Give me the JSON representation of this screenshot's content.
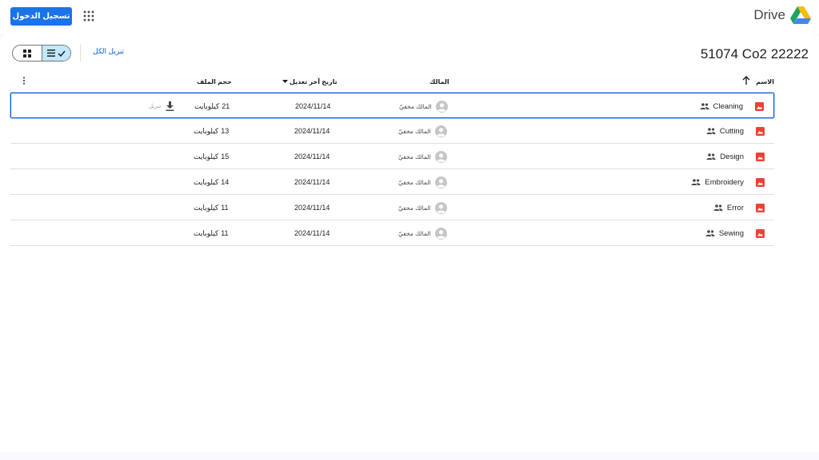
{
  "header": {
    "signin_label": "تسجيل الدخول",
    "brand_name": "Drive"
  },
  "toolbar": {
    "download_all_label": "تنزيل الكل",
    "folder_title": "51074 Co2 22222",
    "view_mode": "list"
  },
  "table": {
    "columns": {
      "name": "الاسم",
      "owner": "المالك",
      "modified": "تاريخ آخر تعديل",
      "size": "حجم الملف"
    },
    "download_label": "تنزيل",
    "rows": [
      {
        "name": "Cleaning",
        "owner": "المالك مخفيّ",
        "modified": "2024/11/14",
        "size_value": "21",
        "size_unit": "كيلوبايت",
        "selected": true
      },
      {
        "name": "Cutting",
        "owner": "المالك مخفيّ",
        "modified": "2024/11/14",
        "size_value": "13",
        "size_unit": "كيلوبايت"
      },
      {
        "name": "Design",
        "owner": "المالك مخفيّ",
        "modified": "2024/11/14",
        "size_value": "15",
        "size_unit": "كيلوبايت"
      },
      {
        "name": "Embroidery",
        "owner": "المالك مخفيّ",
        "modified": "2024/11/14",
        "size_value": "14",
        "size_unit": "كيلوبايت"
      },
      {
        "name": "Error",
        "owner": "المالك مخفيّ",
        "modified": "2024/11/14",
        "size_value": "11",
        "size_unit": "كيلوبايت"
      },
      {
        "name": "Sewing",
        "owner": "المالك مخفيّ",
        "modified": "2024/11/14",
        "size_value": "11",
        "size_unit": "كيلوبايت"
      }
    ]
  },
  "colors": {
    "accent": "#1a73e8",
    "image_icon": "#ea4335",
    "selected_view": "#c2e7ff"
  },
  "icons": {
    "apps": "apps-grid-icon",
    "sort": "arrow-up-icon",
    "shared": "people-icon",
    "file": "image-file-icon",
    "owner": "account-circle-icon",
    "download": "download-icon",
    "more": "more-vert-icon"
  }
}
